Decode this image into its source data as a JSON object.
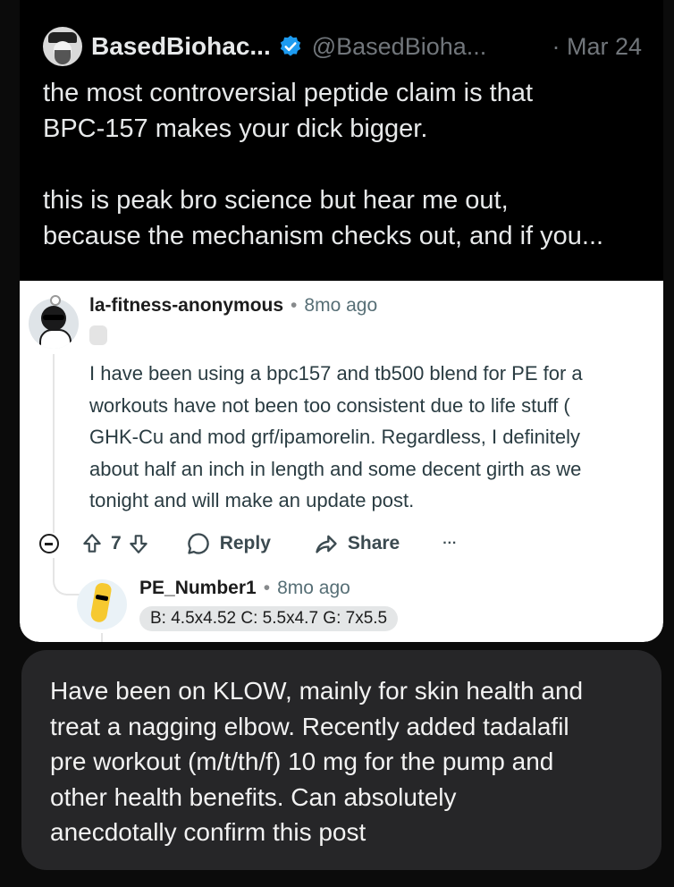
{
  "tweet": {
    "author_name": "BasedBiohac...",
    "handle": "@BasedBioha...",
    "date": "· Mar 24",
    "lines": [
      "the most controversial peptide claim is that",
      "BPC-157 makes your dick bigger.",
      "",
      "this is peak bro science but hear me out,",
      "because the mechanism checks out, and if you..."
    ]
  },
  "reddit": {
    "username": "la-fitness-anonymous",
    "time": "8mo ago",
    "body_lines": [
      "I have been using a bpc157 and tb500 blend for PE for a",
      "workouts have not been too consistent due to life stuff (",
      "GHK-Cu and mod grf/ipamorelin. Regardless, I definitely",
      "about half an inch in length and some decent girth as we",
      "tonight and will make an update post."
    ],
    "vote_count": "7",
    "reply_label": "Reply",
    "share_label": "Share",
    "more_label": "···",
    "reply": {
      "username": "PE_Number1",
      "time": "8mo ago",
      "flair": "B: 4.5x4.52 C: 5.5x4.7 G: 7x5.5"
    }
  },
  "message": {
    "lines": [
      "Have been on KLOW, mainly for skin health and",
      "treat a nagging elbow. Recently added tadalafil",
      "pre workout (m/t/th/f) 10 mg for the pump and",
      "other health benefits. Can absolutely",
      "anecdotally confirm this post"
    ]
  },
  "colors": {
    "verified_badge": "#1d9bf0",
    "bubble": "#262628"
  }
}
